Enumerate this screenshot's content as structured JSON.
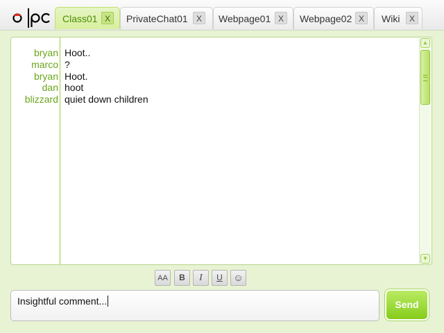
{
  "tabs": [
    {
      "label": "Class01",
      "close": "X",
      "active": true
    },
    {
      "label": "PrivateChat01",
      "close": "X",
      "active": false
    },
    {
      "label": "Webpage01",
      "close": "X",
      "active": false
    },
    {
      "label": "Webpage02",
      "close": "X",
      "active": false
    },
    {
      "label": "Wiki",
      "close": "X",
      "active": false
    }
  ],
  "messages": [
    {
      "name": "bryan",
      "text": "Hoot.."
    },
    {
      "name": "marco",
      "text": "?"
    },
    {
      "name": "bryan",
      "text": "Hoot."
    },
    {
      "name": "dan",
      "text": "hoot"
    },
    {
      "name": "blizzard",
      "text": "quiet down children"
    }
  ],
  "toolbar": {
    "font_size": "AA",
    "bold": "B",
    "italic": "I",
    "underline": "U",
    "emoticon": "☺"
  },
  "input": {
    "value": "Insightful comment..."
  },
  "send_label": "Send",
  "colors": {
    "accent": "#8cc63f",
    "name_text": "#6aa51a",
    "panel_bg": "#e8f3d4"
  }
}
